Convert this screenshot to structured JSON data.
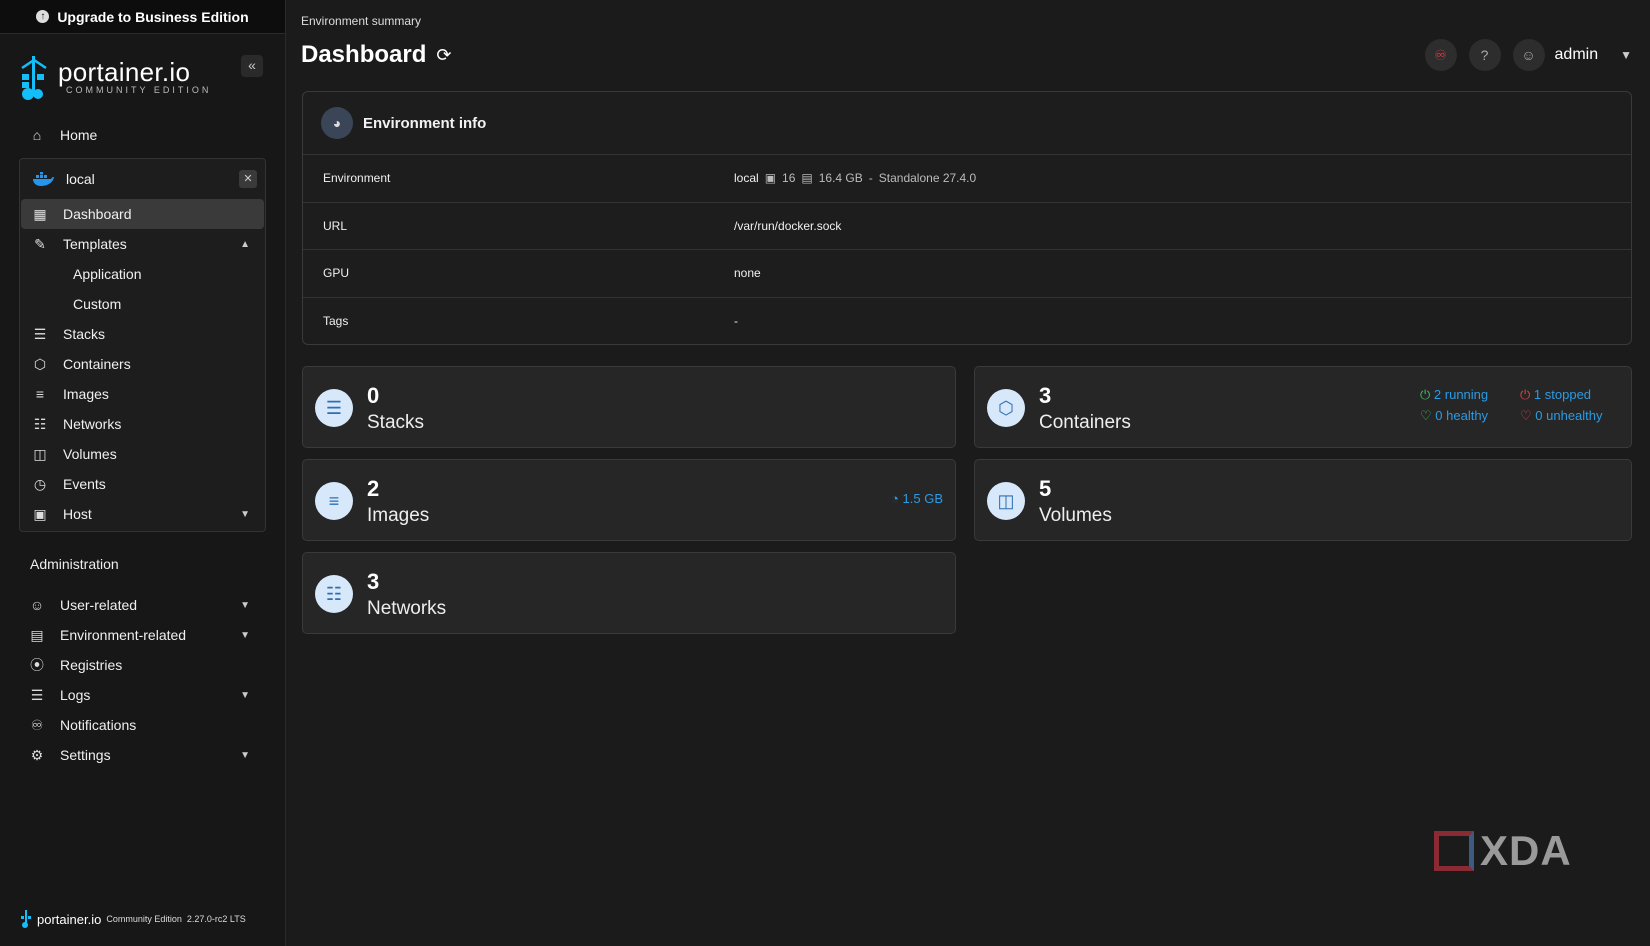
{
  "upgrade": {
    "label": "Upgrade to Business Edition"
  },
  "brand": {
    "name": "portainer.io",
    "edition": "COMMUNITY EDITION"
  },
  "nav": {
    "home": "Home",
    "environment": {
      "name": "local",
      "items": [
        {
          "label": "Dashboard",
          "icon": "dashboard-icon"
        },
        {
          "label": "Templates",
          "icon": "edit-icon"
        },
        {
          "label": "Application",
          "icon": ""
        },
        {
          "label": "Custom",
          "icon": ""
        },
        {
          "label": "Stacks",
          "icon": "layers-icon"
        },
        {
          "label": "Containers",
          "icon": "box-icon"
        },
        {
          "label": "Images",
          "icon": "list-icon"
        },
        {
          "label": "Networks",
          "icon": "network-icon"
        },
        {
          "label": "Volumes",
          "icon": "database-icon"
        },
        {
          "label": "Events",
          "icon": "clock-icon"
        },
        {
          "label": "Host",
          "icon": "host-icon"
        }
      ]
    },
    "administration": {
      "title": "Administration",
      "items": [
        {
          "label": "User-related"
        },
        {
          "label": "Environment-related"
        },
        {
          "label": "Registries"
        },
        {
          "label": "Logs"
        },
        {
          "label": "Notifications"
        },
        {
          "label": "Settings"
        }
      ]
    }
  },
  "footer": {
    "name": "portainer.io",
    "edition": "Community Edition",
    "version": "2.27.0-rc2 LTS"
  },
  "header": {
    "breadcrumb": "Environment summary",
    "title": "Dashboard",
    "user": "admin"
  },
  "env_info": {
    "title": "Environment info",
    "rows": {
      "environment": {
        "key": "Environment",
        "name": "local",
        "cpu": "16",
        "memory": "16.4 GB",
        "sep": "-",
        "type": "Standalone 27.4.0"
      },
      "url": {
        "key": "URL",
        "value": "/var/run/docker.sock"
      },
      "gpu": {
        "key": "GPU",
        "value": "none"
      },
      "tags": {
        "key": "Tags",
        "value": "-"
      }
    }
  },
  "stats": {
    "stacks": {
      "count": "0",
      "label": "Stacks"
    },
    "containers": {
      "count": "3",
      "label": "Containers",
      "running": "2 running",
      "stopped": "1 stopped",
      "healthy": "0 healthy",
      "unhealthy": "0 unhealthy"
    },
    "images": {
      "count": "2",
      "label": "Images",
      "size": "1.5 GB"
    },
    "volumes": {
      "count": "5",
      "label": "Volumes"
    },
    "networks": {
      "count": "3",
      "label": "Networks"
    }
  },
  "watermark": {
    "text": "XDA"
  }
}
